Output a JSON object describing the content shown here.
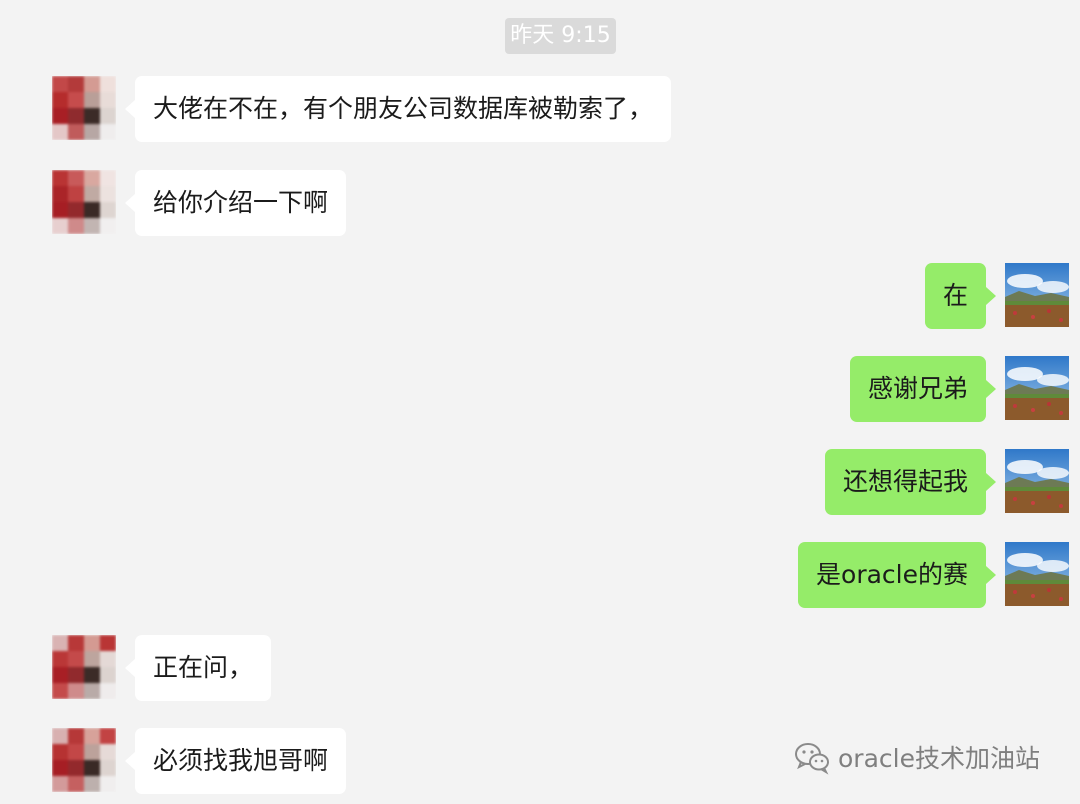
{
  "timestamp": "昨天 9:15",
  "messages": [
    {
      "side": "left",
      "text": "大佬在不在，有个朋友公司数据库被勒索了，"
    },
    {
      "side": "left",
      "text": "给你介绍一下啊"
    },
    {
      "side": "right",
      "text": "在"
    },
    {
      "side": "right",
      "text": "感谢兄弟"
    },
    {
      "side": "right",
      "text": "还想得起我"
    },
    {
      "side": "right",
      "text": "是oracle的赛"
    },
    {
      "side": "left",
      "text": "正在问，"
    },
    {
      "side": "left",
      "text": "必须找我旭哥啊"
    }
  ],
  "watermark": {
    "text": "oracle技术加油站",
    "icon": "wechat-icon"
  },
  "colors": {
    "background": "#f3f3f3",
    "sent_bubble": "#95ec69",
    "received_bubble": "#ffffff",
    "time_pill": "#dadada"
  }
}
